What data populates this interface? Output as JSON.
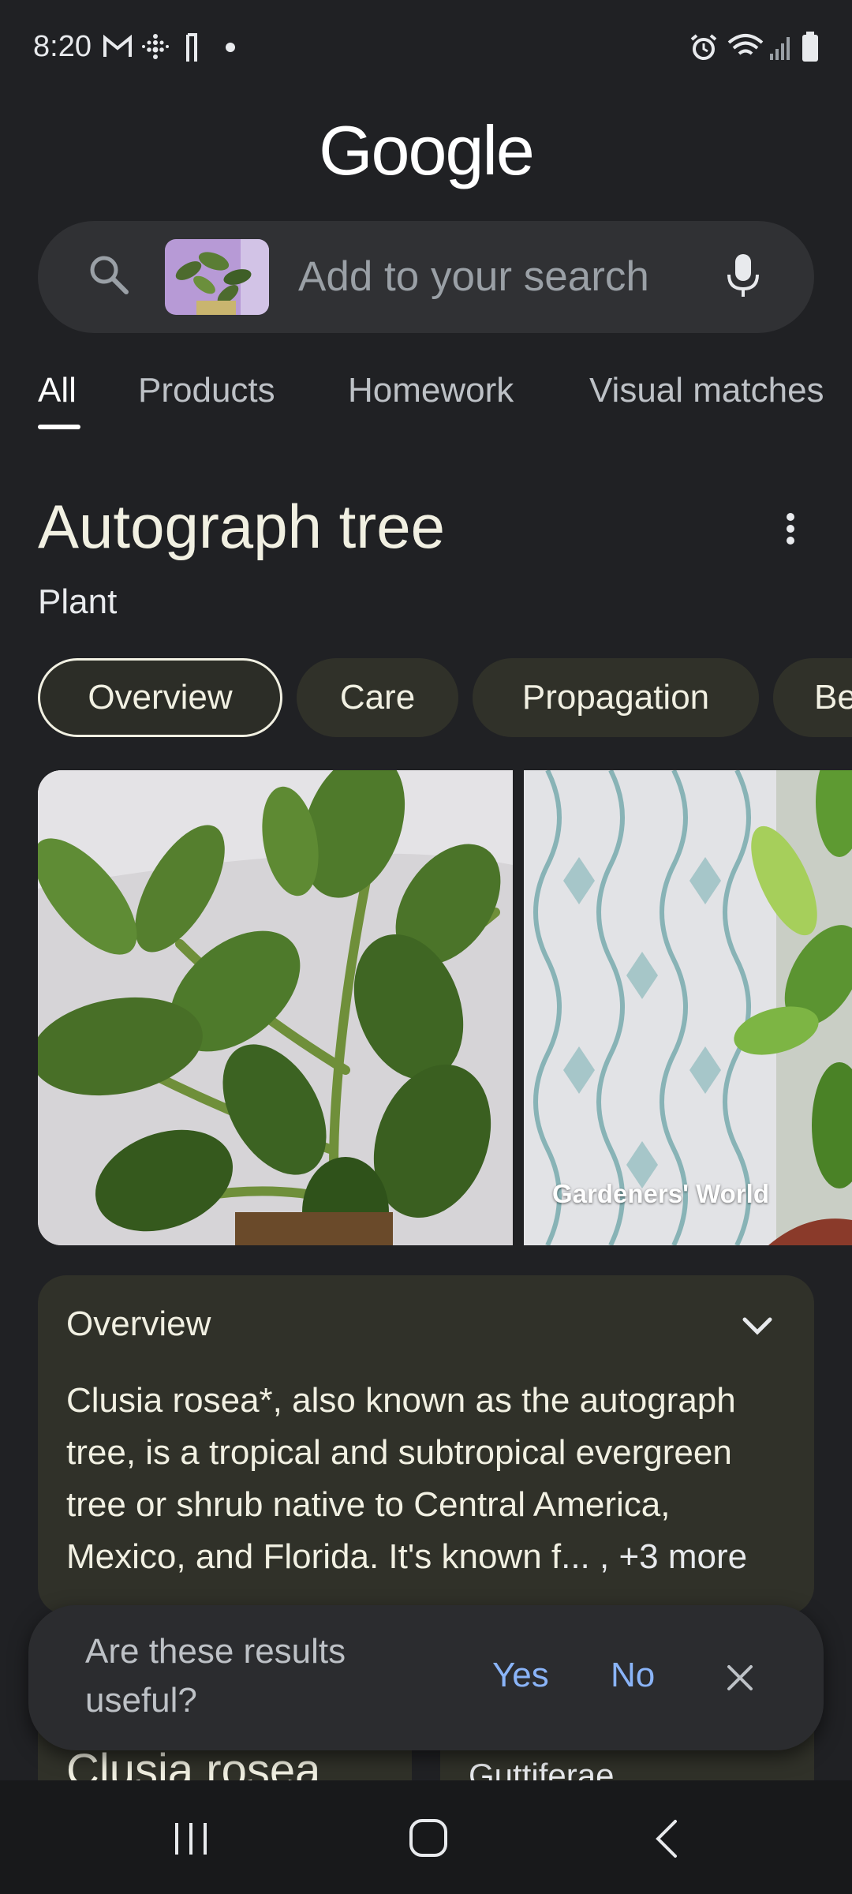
{
  "status_bar": {
    "time": "8:20"
  },
  "header": {
    "logo_text": "Google"
  },
  "search": {
    "placeholder": "Add to your search"
  },
  "tabs": [
    {
      "label": "All"
    },
    {
      "label": "Products"
    },
    {
      "label": "Homework"
    },
    {
      "label": "Visual matches"
    }
  ],
  "entity": {
    "title": "Autograph tree",
    "subtitle": "Plant"
  },
  "chips": [
    {
      "label": "Overview"
    },
    {
      "label": "Care"
    },
    {
      "label": "Propagation"
    },
    {
      "label": "Be"
    }
  ],
  "images": [
    {
      "caption": ""
    },
    {
      "caption": "Gardeners' World"
    }
  ],
  "overview": {
    "title": "Overview",
    "text": "Clusia rosea*, also known as the autograph tree, is a tropical and subtropical evergreen tree or shrub native to Central America, Mexico, and Florida. It's known f",
    "more": "... , +3 more"
  },
  "facts": {
    "left": "Clusia rosea",
    "right": "Guttiferae"
  },
  "feedback": {
    "question": "Are these results useful?",
    "yes": "Yes",
    "no": "No"
  },
  "colors": {
    "accent": "#8ab4f8",
    "background": "#202124",
    "card": "#303129"
  }
}
